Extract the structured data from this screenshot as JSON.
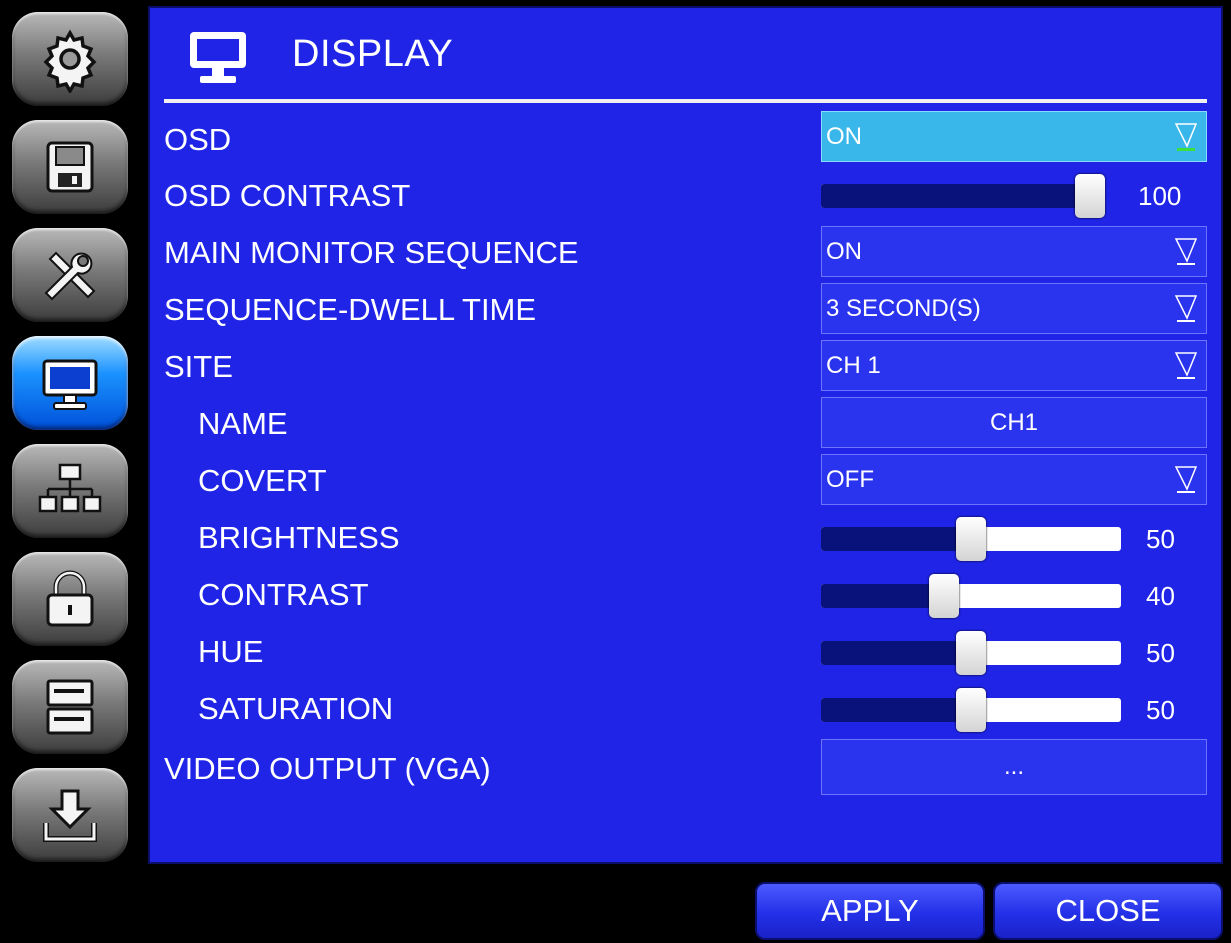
{
  "sidebar": {
    "items": [
      {
        "icon": "gear-icon",
        "active": false
      },
      {
        "icon": "floppy-disk-icon",
        "active": false
      },
      {
        "icon": "tools-icon",
        "active": false
      },
      {
        "icon": "monitor-icon",
        "active": true
      },
      {
        "icon": "network-icon",
        "active": false
      },
      {
        "icon": "lock-icon",
        "active": false
      },
      {
        "icon": "storage-icon",
        "active": false
      },
      {
        "icon": "download-icon",
        "active": false
      }
    ]
  },
  "header": {
    "title": "DISPLAY",
    "icon": "monitor-icon"
  },
  "settings": {
    "osd": {
      "label": "OSD",
      "value": "ON"
    },
    "osd_contrast": {
      "label": "OSD CONTRAST",
      "value": "100",
      "level": 100
    },
    "main_monitor_sequence": {
      "label": "MAIN MONITOR SEQUENCE",
      "value": "ON"
    },
    "sequence_dwell_time": {
      "label": "SEQUENCE-DWELL TIME",
      "value": "3 SECOND(S)"
    },
    "site": {
      "label": "SITE",
      "value": "CH 1"
    },
    "name": {
      "label": "NAME",
      "value": "CH1"
    },
    "covert": {
      "label": "COVERT",
      "value": "OFF"
    },
    "brightness": {
      "label": "BRIGHTNESS",
      "value": "50",
      "level": 50
    },
    "contrast": {
      "label": "CONTRAST",
      "value": "40",
      "level": 40
    },
    "hue": {
      "label": "HUE",
      "value": "50",
      "level": 50
    },
    "saturation": {
      "label": "SATURATION",
      "value": "50",
      "level": 50
    },
    "video_output": {
      "label": "VIDEO OUTPUT (VGA)",
      "value": "..."
    }
  },
  "buttons": {
    "apply": "APPLY",
    "close": "CLOSE"
  },
  "colors": {
    "panel": "#1f24e6",
    "highlight_field": "#39b7ea",
    "slider_fill": "#09117a",
    "active_sidebar": "#1a92ff"
  }
}
